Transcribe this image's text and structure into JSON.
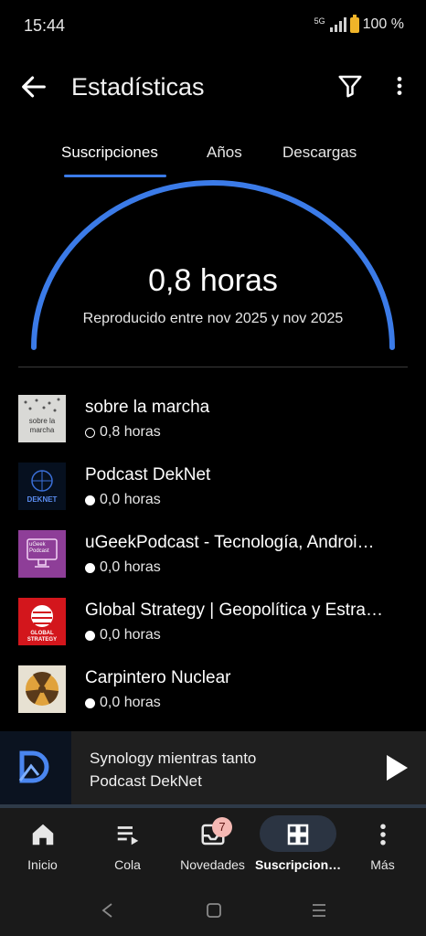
{
  "status_bar": {
    "time": "15:44",
    "network": "5G",
    "battery": "100 %",
    "battery_color": "#f0b429"
  },
  "app_bar": {
    "title": "Estadísticas",
    "back_icon": "arrow-left-icon",
    "filter_icon": "filter-icon",
    "more_icon": "more-vert-icon"
  },
  "tabs": [
    {
      "label": "Suscripciones",
      "active": true
    },
    {
      "label": "Años",
      "active": false
    },
    {
      "label": "Descargas",
      "active": false
    }
  ],
  "summary": {
    "total": "0,8 horas",
    "range": "Reproducido entre nov 2025 y nov 2025",
    "accent": "#3b7be8"
  },
  "podcasts": [
    {
      "title": "sobre la marcha",
      "hours": "0,8 horas",
      "marker": "ring",
      "art_text": "sobre la marcha"
    },
    {
      "title": "Podcast DekNet",
      "hours": "0,0 horas",
      "marker": "dot",
      "art_text": "DEKNET"
    },
    {
      "title": "uGeekPodcast - Tecnología, Androi…",
      "hours": "0,0 horas",
      "marker": "dot",
      "art_text": "uGeek Podcast"
    },
    {
      "title": "Global Strategy | Geopolítica y Estra…",
      "hours": "0,0 horas",
      "marker": "dot",
      "art_text": "GLOBAL STRATEGY"
    },
    {
      "title": "Carpintero Nuclear",
      "hours": "0,0 horas",
      "marker": "dot",
      "art_text": ""
    }
  ],
  "player": {
    "episode": "Synology mientras tanto",
    "podcast": "Podcast DekNet",
    "play_icon": "play-icon"
  },
  "bottom_nav": [
    {
      "label": "Inicio",
      "icon": "home-icon",
      "active": false
    },
    {
      "label": "Cola",
      "icon": "queue-icon",
      "active": false
    },
    {
      "label": "Novedades",
      "icon": "inbox-icon",
      "active": false,
      "badge": "7"
    },
    {
      "label": "Suscripcion…",
      "icon": "grid-icon",
      "active": true
    },
    {
      "label": "Más",
      "icon": "more-vert-icon",
      "active": false
    }
  ]
}
